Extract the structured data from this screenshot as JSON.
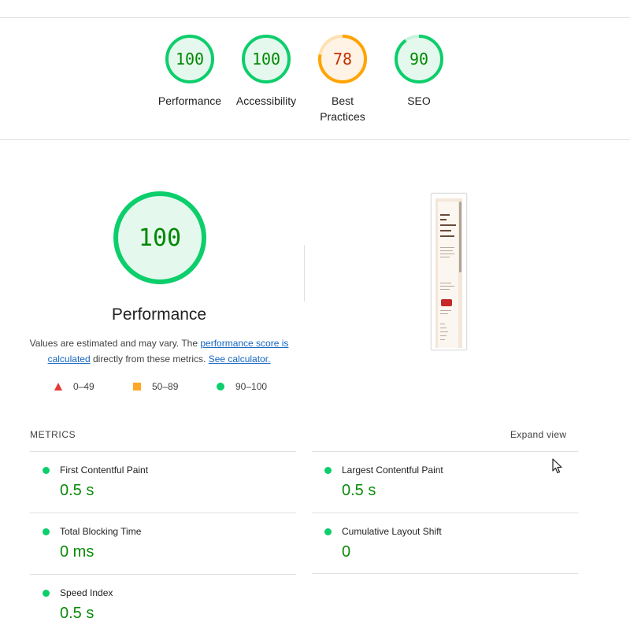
{
  "colors": {
    "pass": "#0cce6b",
    "pass_text": "#008800",
    "average": "#ffa400",
    "average_text": "#c33300",
    "fail": "#ff4e42",
    "link": "#1565c0"
  },
  "categories": [
    {
      "name": "Performance",
      "score": "100",
      "value": 1.0,
      "rating": "pass"
    },
    {
      "name": "Accessibility",
      "score": "100",
      "value": 1.0,
      "rating": "pass"
    },
    {
      "name": "Best Practices",
      "line1": "Best",
      "line2": "Practices",
      "score": "78",
      "value": 0.78,
      "rating": "average"
    },
    {
      "name": "SEO",
      "score": "90",
      "value": 0.9,
      "rating": "pass"
    }
  ],
  "performance": {
    "score": "100",
    "value": 1.0,
    "title": "Performance",
    "desc_prefix": "Values are estimated and may vary. The ",
    "desc_link1": "performance score is calculated",
    "desc_middle": " directly from these metrics. ",
    "desc_link2": "See calculator."
  },
  "legend": {
    "fail": "0–49",
    "average": "50–89",
    "pass": "90–100"
  },
  "metrics": {
    "heading": "METRICS",
    "expand_label": "Expand view",
    "items": [
      {
        "name": "First Contentful Paint",
        "value": "0.5 s"
      },
      {
        "name": "Largest Contentful Paint",
        "value": "0.5 s"
      },
      {
        "name": "Total Blocking Time",
        "value": "0 ms"
      },
      {
        "name": "Cumulative Layout Shift",
        "value": "0"
      },
      {
        "name": "Speed Index",
        "value": "0.5 s"
      }
    ]
  },
  "thumbnail": {
    "text_lines": [
      "Tune",
      "In.",
      "Breathe",
      "Deep.",
      "Create."
    ],
    "icon": "youtube-play-icon"
  }
}
